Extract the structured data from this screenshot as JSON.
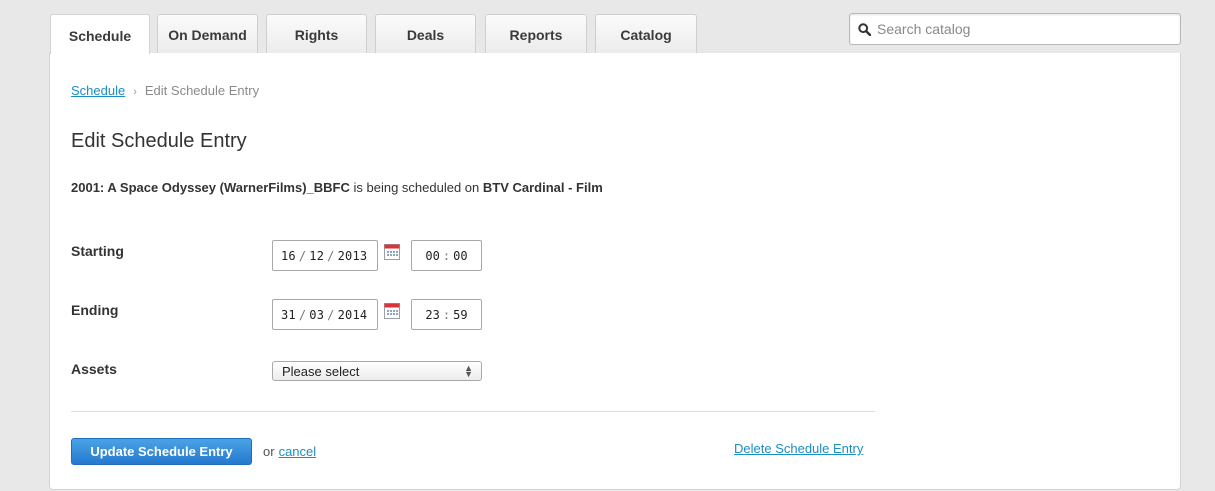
{
  "tabs": [
    {
      "label": "Schedule",
      "active": true
    },
    {
      "label": "On Demand",
      "active": false
    },
    {
      "label": "Rights",
      "active": false
    },
    {
      "label": "Deals",
      "active": false
    },
    {
      "label": "Reports",
      "active": false
    },
    {
      "label": "Catalog",
      "active": false
    }
  ],
  "search": {
    "placeholder": "Search catalog",
    "icon": "search-icon"
  },
  "breadcrumb": {
    "link": "Schedule",
    "separator": "›",
    "current": "Edit Schedule Entry"
  },
  "page_title": "Edit Schedule Entry",
  "summary": {
    "title": "2001: A Space Odyssey (WarnerFilms)_BBFC",
    "middle": " is being scheduled on ",
    "channel": "BTV Cardinal - Film"
  },
  "form": {
    "starting": {
      "label": "Starting",
      "day": "16",
      "month": "12",
      "year": "2013",
      "hour": "00",
      "minute": "00"
    },
    "ending": {
      "label": "Ending",
      "day": "31",
      "month": "03",
      "year": "2014",
      "hour": "23",
      "minute": "59"
    },
    "assets": {
      "label": "Assets",
      "selected": "Please select"
    }
  },
  "actions": {
    "update_label": "Update Schedule Entry",
    "or_text": "or",
    "cancel_label": "cancel",
    "delete_label": "Delete Schedule Entry"
  },
  "colors": {
    "accent": "#2579cf",
    "link": "#1b8ec2",
    "calendar_top": "#d9333b"
  }
}
